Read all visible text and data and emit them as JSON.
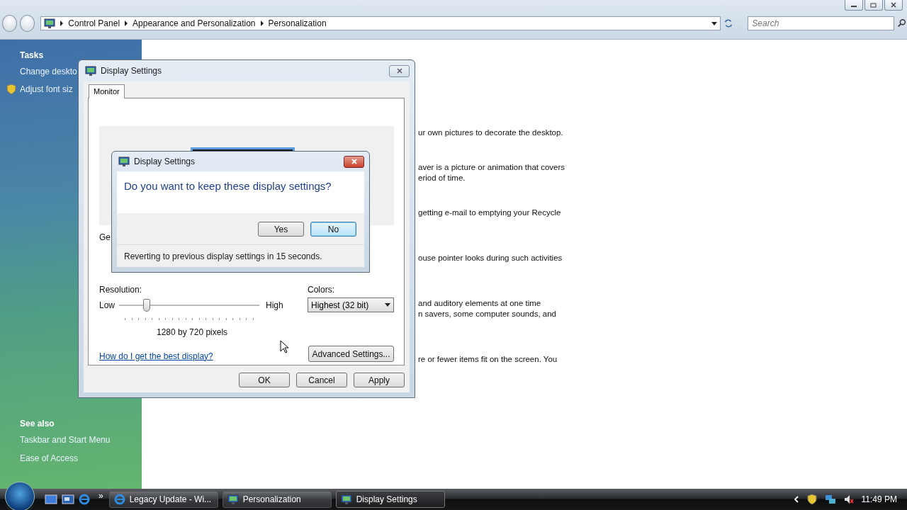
{
  "explorer": {
    "breadcrumb": [
      "Control Panel",
      "Appearance and Personalization",
      "Personalization"
    ],
    "search": {
      "placeholder": "Search"
    },
    "sidebar": {
      "tasks_heading": "Tasks",
      "tasks": [
        "Change deskto",
        "Adjust font siz"
      ],
      "see_also_heading": "See also",
      "see_also": [
        "Taskbar and Start Menu",
        "Ease of Access"
      ]
    },
    "content": [
      [
        "ur own pictures to decorate the desktop."
      ],
      [
        "aver is a picture or animation that covers",
        "eriod of time."
      ],
      [
        "getting e-mail to emptying your Recycle"
      ],
      [
        "ouse pointer looks during such activities"
      ],
      [
        "and auditory elements at one time",
        "n savers, some computer sounds, and"
      ],
      [
        "re or fewer items fit on the screen. You"
      ]
    ]
  },
  "display_settings": {
    "title": "Display Settings",
    "tabs": [
      {
        "label": "Monitor",
        "selected": true
      }
    ],
    "partial_label": "Ge",
    "resolution": {
      "label": "Resolution:",
      "low": "Low",
      "high": "High",
      "level": 0.18,
      "reading": "1280 by 720 pixels"
    },
    "colors": {
      "label": "Colors:",
      "value": "Highest (32 bit)"
    },
    "help_link": "How do I get the best display?",
    "advanced_button": "Advanced Settings...",
    "buttons": [
      "OK",
      "Cancel",
      "Apply"
    ]
  },
  "confirm": {
    "title": "Display Settings",
    "question": "Do you want to keep these display settings?",
    "buttons": [
      {
        "label": "Yes",
        "default": false
      },
      {
        "label": "No",
        "default": true
      }
    ],
    "footer": "Reverting to previous display settings in 15 seconds."
  },
  "taskbar": {
    "overflow": "»",
    "tasks": [
      {
        "label": "Legacy Update - Wi...",
        "selected": false
      },
      {
        "label": "Personalization",
        "selected": false
      },
      {
        "label": "Display Settings",
        "selected": true
      }
    ],
    "clock": "11:49 PM"
  }
}
